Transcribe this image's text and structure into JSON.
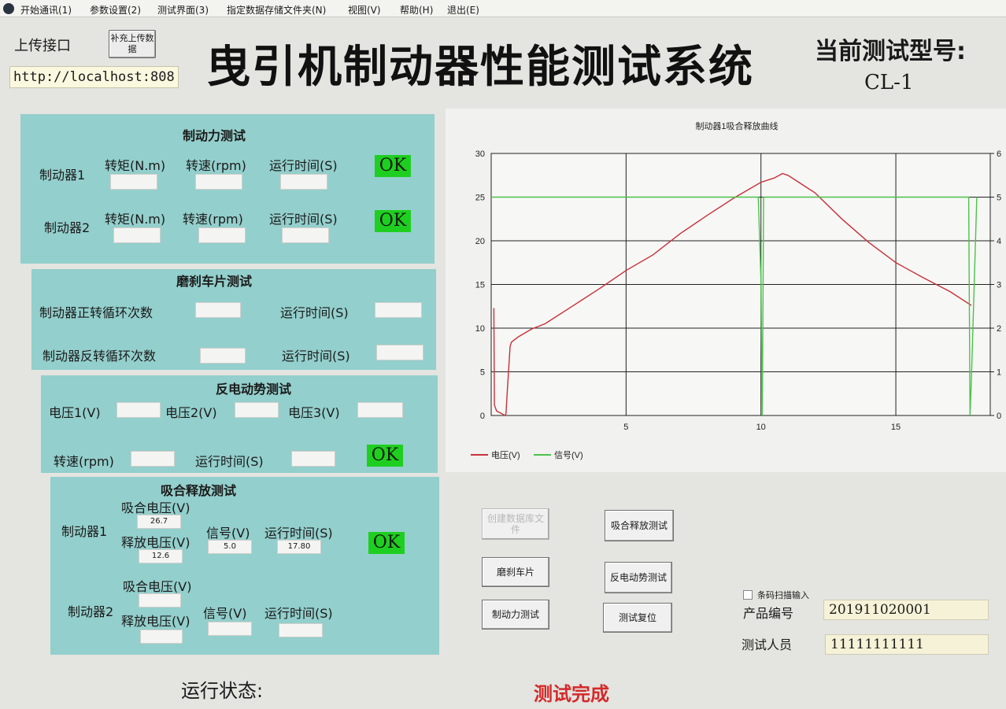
{
  "menu": [
    "开始通讯(1)",
    "参数设置(2)",
    "测试界面(3)",
    "指定数据存储文件夹(N)",
    "视图(V)",
    "帮助(H)",
    "退出(E)"
  ],
  "header": {
    "upload_label": "上传接口",
    "supplement_button": "补充上传数据",
    "url_value": "http://localhost:808",
    "title": "曳引机制动器性能测试系统",
    "model_label": "当前测试型号:",
    "model_value": "CL-1"
  },
  "braking_test": {
    "title": "制动力测试",
    "brake1_label": "制动器1",
    "brake2_label": "制动器2",
    "torque_label": "转矩(N.m)",
    "speed_label": "转速(rpm)",
    "speed_label_2": "转速(rpm)",
    "runtime_label": "运行时间(S)",
    "ok": "OK"
  },
  "pad_test": {
    "title": "磨刹车片测试",
    "forward_label": "制动器正转循环次数",
    "reverse_label": "制动器反转循环次数",
    "runtime_label": "运行时间(S)"
  },
  "emf_test": {
    "title": "反电动势测试",
    "v1_label": "电压1(V)",
    "v2_label": "电压2(V)",
    "v3_label": "电压3(V)",
    "speed_label": "转速(rpm)",
    "runtime_label": "运行时间(S)",
    "ok": "OK"
  },
  "pull_release_test": {
    "title": "吸合释放测试",
    "brake1_label": "制动器1",
    "brake2_label": "制动器2",
    "pull_voltage_label": "吸合电压(V)",
    "release_voltage_label": "释放电压(V)",
    "signal_label": "信号(V)",
    "runtime_label": "运行时间(S)",
    "brake1": {
      "pull_voltage": "26.7",
      "release_voltage": "12.6",
      "signal": "5.0",
      "runtime": "17.80"
    },
    "ok": "OK"
  },
  "chart_data": {
    "type": "line",
    "title": "制动器1吸合释放曲线",
    "xlim": [
      0,
      18.5
    ],
    "ylim": [
      0,
      30
    ],
    "y2lim": [
      0,
      6
    ],
    "x_ticks": [
      "5",
      "10",
      "15"
    ],
    "y_ticks": [
      "0",
      "5",
      "10",
      "15",
      "20",
      "25",
      "30"
    ],
    "y2_ticks": [
      "0",
      "1",
      "2",
      "3",
      "4",
      "5",
      "6"
    ],
    "grid": true,
    "legend": "bottom-left",
    "series": [
      {
        "name": "电压(V)",
        "color": "#c8303a",
        "axis": "left",
        "x": [
          0.1,
          0.12,
          0.2,
          0.4,
          0.5,
          0.55,
          0.6,
          0.7,
          0.75,
          1.0,
          1.5,
          2.0,
          3.0,
          4.0,
          5.0,
          6.0,
          7.0,
          8.0,
          9.0,
          10.0,
          10.5,
          10.8,
          11.0,
          12.0,
          13.0,
          14.0,
          15.0,
          16.0,
          17.0,
          17.8
        ],
        "y": [
          12.3,
          1.2,
          0.5,
          0.2,
          0.0,
          0.2,
          3.0,
          7.9,
          8.4,
          9.0,
          9.9,
          10.5,
          12.5,
          14.5,
          16.6,
          18.4,
          20.8,
          22.9,
          24.9,
          26.7,
          27.2,
          27.7,
          27.5,
          25.5,
          22.5,
          19.8,
          17.5,
          15.8,
          14.2,
          12.6
        ]
      },
      {
        "name": "信号(V)",
        "color": "#4bc24b",
        "axis": "right",
        "x": [
          0.0,
          9.9,
          10.0,
          10.05,
          10.1,
          10.15,
          17.7,
          17.75,
          17.8,
          18.0
        ],
        "y": [
          5.0,
          5.0,
          3.1,
          0.0,
          5.0,
          5.0,
          5.0,
          0.0,
          0.8,
          5.0
        ]
      }
    ]
  },
  "buttons": {
    "create_db": "创建数据库文件",
    "pull_release": "吸合释放测试",
    "grind_pad": "磨刹车片",
    "emf": "反电动势测试",
    "braking": "制动力测试",
    "reset": "测试复位"
  },
  "product": {
    "barcode_label": "条码扫描输入",
    "product_no_label": "产品编号",
    "product_no": "201911020001",
    "tester_label": "测试人员",
    "tester": "11111111111"
  },
  "status": {
    "label": "运行状态:",
    "value": "测试完成"
  }
}
